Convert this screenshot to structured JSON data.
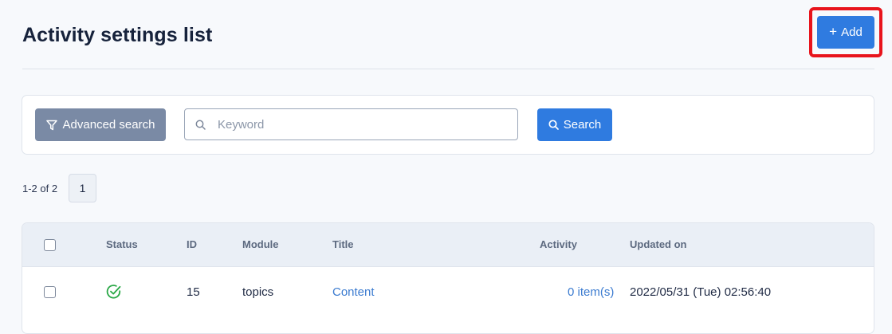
{
  "header": {
    "title": "Activity settings list",
    "add_label": "Add"
  },
  "search": {
    "advanced_label": "Advanced search",
    "keyword_placeholder": "Keyword",
    "keyword_value": "",
    "search_label": "Search"
  },
  "pagination": {
    "range_text": "1-2 of 2",
    "current_page": "1"
  },
  "table": {
    "columns": [
      "Status",
      "ID",
      "Module",
      "Title",
      "Activity",
      "Updated on"
    ],
    "rows": [
      {
        "status": "active",
        "id": "15",
        "module": "topics",
        "title": "Content",
        "activity": "0 item(s)",
        "updated_on": "2022/05/31 (Tue) 02:56:40"
      }
    ]
  },
  "icons": {
    "add": "plus-icon",
    "advanced": "filter-icon",
    "keyword": "search-icon",
    "search": "search-icon",
    "status": "check-circle-icon"
  },
  "colors": {
    "primary": "#2f7be0",
    "secondary": "#7a8aa5",
    "highlight": "#e8141c",
    "status_ok": "#28a745",
    "link": "#3b7bd0"
  }
}
